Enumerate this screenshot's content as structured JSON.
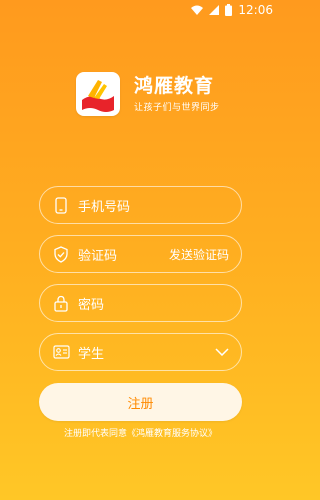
{
  "status": {
    "time": "12:06"
  },
  "brand": {
    "name": "鸿雁教育",
    "slogan": "让孩子们与世界同步"
  },
  "form": {
    "phone_label": "手机号码",
    "code_label": "验证码",
    "send_code_label": "发送验证码",
    "password_label": "密码",
    "role_selected": "学生"
  },
  "register": {
    "label": "注册"
  },
  "agreement": {
    "text": "注册即代表同意《鸿雁教育服务协议》"
  }
}
